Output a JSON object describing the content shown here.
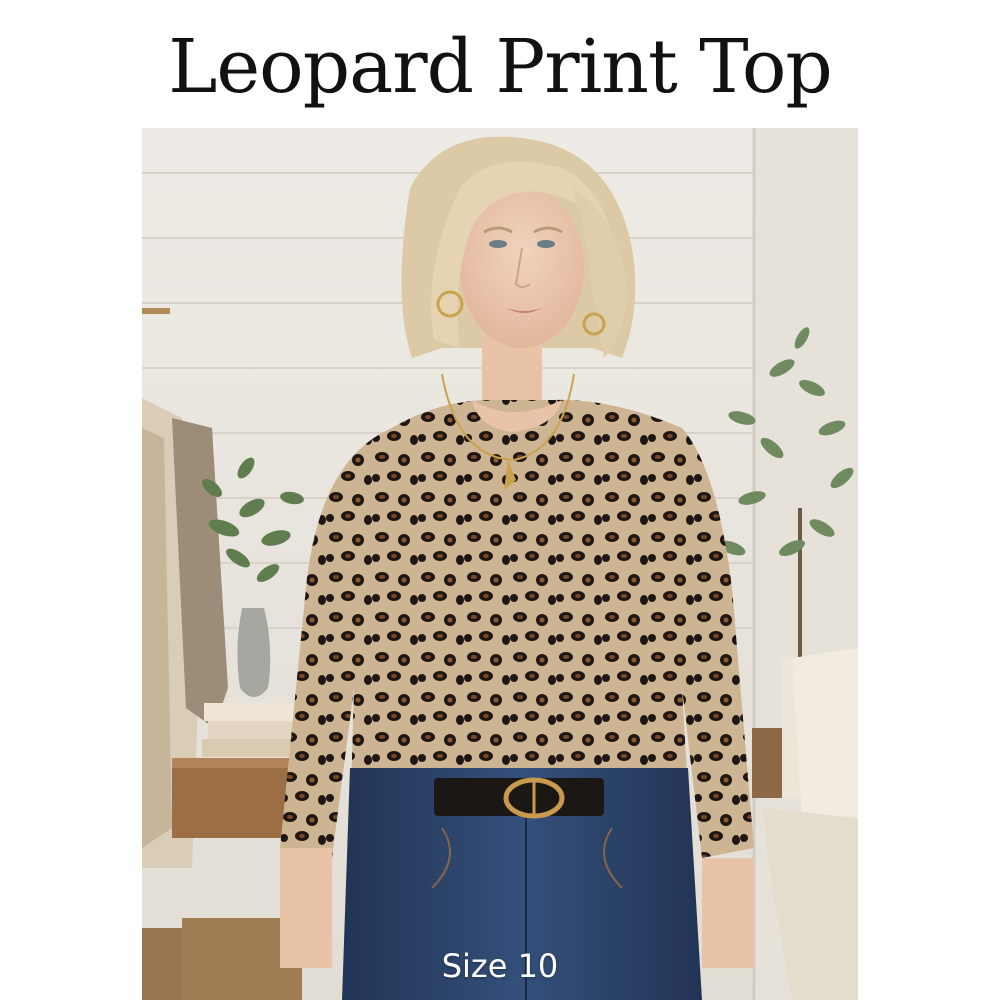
{
  "product": {
    "title": "Leopard Print Top",
    "size_label": "Size 10"
  },
  "colors": {
    "background": "#ffffff",
    "title_text": "#111111",
    "top_base": "#cdb493",
    "spot_dark": "#1e1612",
    "spot_brown": "#7a4a28",
    "denim": "#2b3f63",
    "wall": "#ece8e1"
  }
}
